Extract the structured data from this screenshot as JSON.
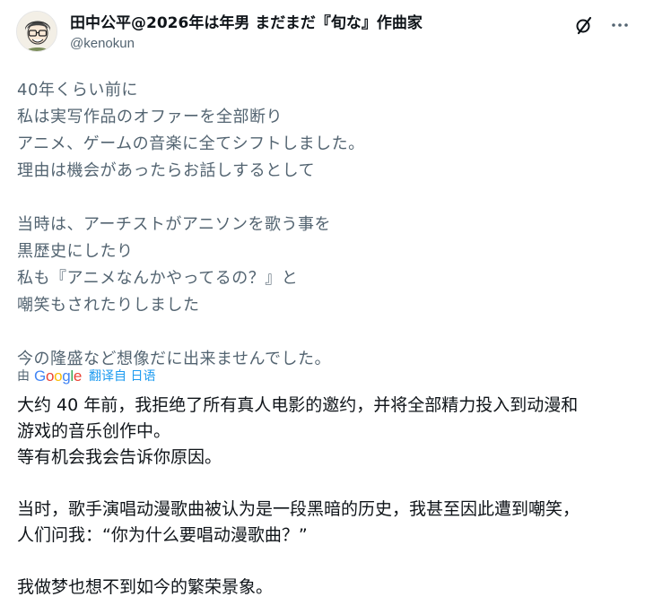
{
  "author": {
    "display_name": "田中公平@2026年は年男 まだまだ『旬な』作曲家",
    "handle": "@kenokun"
  },
  "post": {
    "original_lines": [
      "40年くらい前に",
      "私は実写作品のオファーを全部断り",
      "アニメ、ゲームの音楽に全てシフトしました。",
      "理由は機会があったらお話しするとして",
      "",
      "当時は、アーチストがアニソンを歌う事を",
      "黒歴史にしたり",
      "私も『アニメなんかやってるの？』と",
      "嘲笑もされたりしました",
      "",
      "今の隆盛など想像だに出来ませんでした。"
    ],
    "translate": {
      "by_label": "由",
      "provider": "Google",
      "action_label": "翻译自 日语"
    },
    "translated_lines": [
      "大约 40 年前，我拒绝了所有真人电影的邀约，并将全部精力投入到动漫和",
      "游戏的音乐创作中。",
      "等有机会我会告诉你原因。",
      "",
      "当时，歌手演唱动漫歌曲被认为是一段黑暗的历史，我甚至因此遭到嘲笑，",
      "人们问我：“你为什么要唱动漫歌曲？”",
      "",
      "我做梦也想不到如今的繁荣景象。"
    ]
  },
  "icons": {
    "grok": "grok-slash-icon",
    "more": "more-horizontal-icon"
  },
  "colors": {
    "text_primary": "#0f1419",
    "text_secondary": "#536471",
    "link": "#1d9bf0",
    "google_blue": "#4285f4",
    "google_red": "#ea4335",
    "google_yellow": "#fbbc05",
    "google_green": "#34a853"
  }
}
